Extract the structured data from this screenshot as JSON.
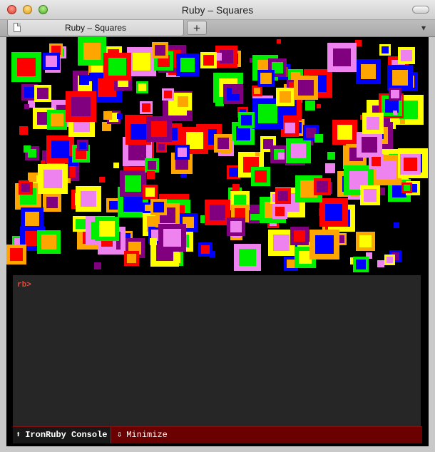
{
  "window": {
    "title": "Ruby – Squares"
  },
  "tab": {
    "label": "Ruby – Squares",
    "add_label": "+",
    "menu_icon": "▾"
  },
  "console": {
    "prompt": "rb>",
    "tab_label": "IronRuby Console",
    "tab_icon": "⬆",
    "minimize_label": "Minimize",
    "minimize_icon": "⇩"
  },
  "palette": {
    "red": "#ff0000",
    "green": "#00ee00",
    "blue": "#0000ff",
    "yellow": "#ffff00",
    "orange": "#ffa500",
    "violet": "#ee82ee",
    "purple": "#800080",
    "black_bg": "#000000",
    "console_bg": "#262626",
    "console_bar": "#6b0000",
    "prompt_color": "#e04a3a"
  }
}
